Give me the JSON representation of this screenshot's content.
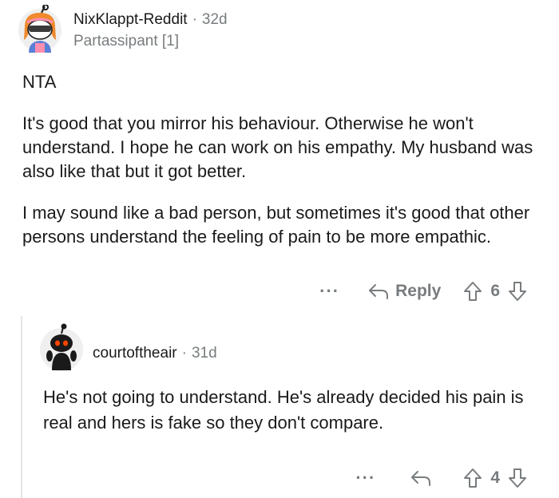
{
  "parent_comment": {
    "username": "NixKlappt-Reddit",
    "separator": "·",
    "age": "32d",
    "flair": "Partassipant [1]",
    "body": [
      "NTA",
      "It's good that you mirror his behaviour. Otherwise he won't understand. I hope he can work on his empathy. My husband was also like that but it got better.",
      "I may sound like a bad person, but sometimes it's good that other persons understand the feeling of pain to be more empathic."
    ],
    "actions": {
      "more_label": "···",
      "reply_label": "Reply",
      "score": "6"
    }
  },
  "child_comment": {
    "username": "courtoftheair",
    "separator": "·",
    "age": "31d",
    "body": "He's not going to understand. He's already decided his pain is real and hers is fake so they don't compare.",
    "actions": {
      "more_label": "···",
      "score": "4"
    }
  },
  "colors": {
    "text": "#1a1a1b",
    "meta": "#787c7e",
    "thread_line": "#e5e5e5",
    "avatar_orange": "#ff4500"
  },
  "icons": [
    "reply-arrow-icon",
    "upvote-arrow-icon",
    "downvote-arrow-icon"
  ]
}
